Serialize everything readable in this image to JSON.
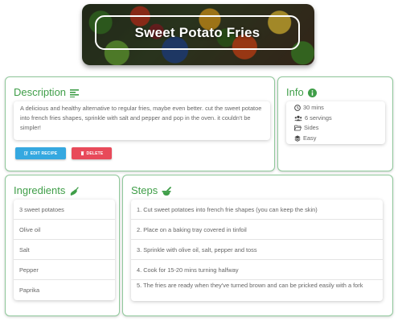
{
  "header": {
    "title": "Sweet Potato Fries"
  },
  "description": {
    "heading": "Description",
    "icon": "align-left-icon",
    "text": "A delicious and healthy alternative to regular fries, maybe even better. cut the sweet potatoe into french fries shapes, sprinkle with salt and pepper and pop in the oven. it couldn't be simpler!",
    "edit_label": "EDIT RECIPE",
    "delete_label": "DELETE"
  },
  "info": {
    "heading": "Info",
    "icon": "info-circle-icon",
    "time": "30 mins",
    "servings": "6 servings",
    "category": "Sides",
    "difficulty": "Easy"
  },
  "ingredients": {
    "heading": "Ingredients",
    "icon": "pepper-icon",
    "items": [
      "3 sweet potatoes",
      "Olive oil",
      "Salt",
      "Pepper",
      "Paprika"
    ]
  },
  "steps": {
    "heading": "Steps",
    "icon": "mortar-pestle-icon",
    "items": [
      "1. Cut sweet potatoes into french frie shapes (you can keep the skin)",
      "2. Place on a baking tray covered in tinfoil",
      "3. Sprinkle with olive oil, salt, pepper and toss",
      "4. Cook for 15-20 mins turning halfway",
      "5. The fries are ready when they've turned brown and can be pricked easily with a fork"
    ]
  },
  "colors": {
    "accent": "#3f9e48",
    "border": "#8fc89a",
    "edit": "#35a8e0",
    "delete": "#e84a5a"
  }
}
